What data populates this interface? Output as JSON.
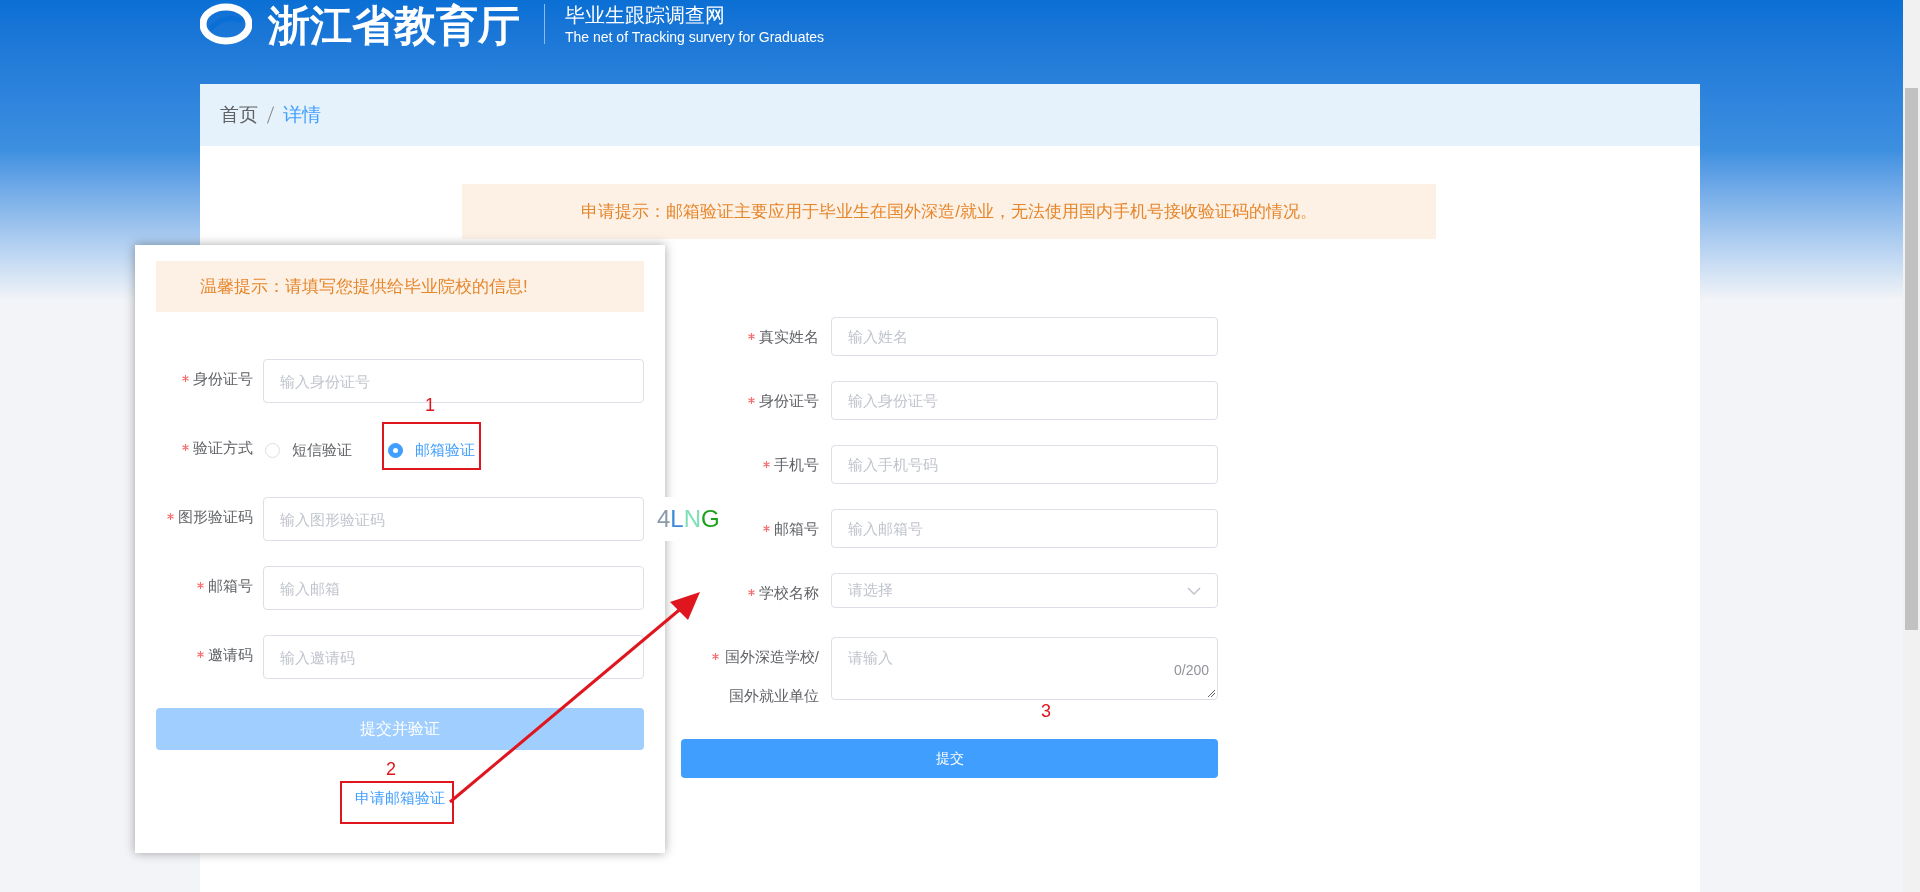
{
  "header": {
    "title": "浙江省教育厅",
    "subtitle": "毕业生跟踪调查网",
    "subtitle_en": "The net of Tracking survery for Graduates"
  },
  "breadcrumb": [
    {
      "label": "首页",
      "selected": false
    },
    {
      "label": "详情",
      "selected": true
    }
  ],
  "notice": "申请提示：邮箱验证主要应用于毕业生在国外深造/就业，无法使用国内手机号接收验证码的情况。",
  "form": {
    "fields": [
      {
        "kind": "input",
        "label": "真实姓名",
        "placeholder": "输入姓名"
      },
      {
        "kind": "input",
        "label": "身份证号",
        "placeholder": "输入身份证号"
      },
      {
        "kind": "input",
        "label": "手机号",
        "placeholder": "输入手机号码"
      },
      {
        "kind": "input",
        "label": "邮箱号",
        "placeholder": "输入邮箱号"
      },
      {
        "kind": "select",
        "label": "学校名称",
        "placeholder": "请选择"
      },
      {
        "kind": "textarea",
        "label": "国外深造学校/国外就业单位",
        "placeholder": "请输入",
        "counter": "0/200"
      }
    ],
    "submit": "提交"
  },
  "popup": {
    "notice": "温馨提示：请填写您提供给毕业院校的信息!",
    "fields": [
      {
        "kind": "input",
        "label": "身份证号",
        "placeholder": "输入身份证号"
      },
      {
        "kind": "radio",
        "label": "验证方式",
        "options": [
          {
            "label": "短信验证",
            "selected": false
          },
          {
            "label": "邮箱验证",
            "selected": true
          }
        ]
      },
      {
        "kind": "captcha",
        "label": "图形验证码",
        "placeholder": "输入图形验证码",
        "captcha": [
          {
            "char": "4",
            "color": "#8a9aa8"
          },
          {
            "char": "L",
            "color": "#3b8ad9"
          },
          {
            "char": "N",
            "color": "#7fe0b8"
          },
          {
            "char": "G",
            "color": "#1aa31a"
          }
        ]
      },
      {
        "kind": "input",
        "label": "邮箱号",
        "placeholder": "输入邮箱"
      },
      {
        "kind": "input",
        "label": "邀请码",
        "placeholder": "输入邀请码"
      }
    ],
    "submit": "提交并验证",
    "submit_disabled": true,
    "link": "申请邮箱验证"
  },
  "annotations": [
    "1",
    "2",
    "3"
  ]
}
